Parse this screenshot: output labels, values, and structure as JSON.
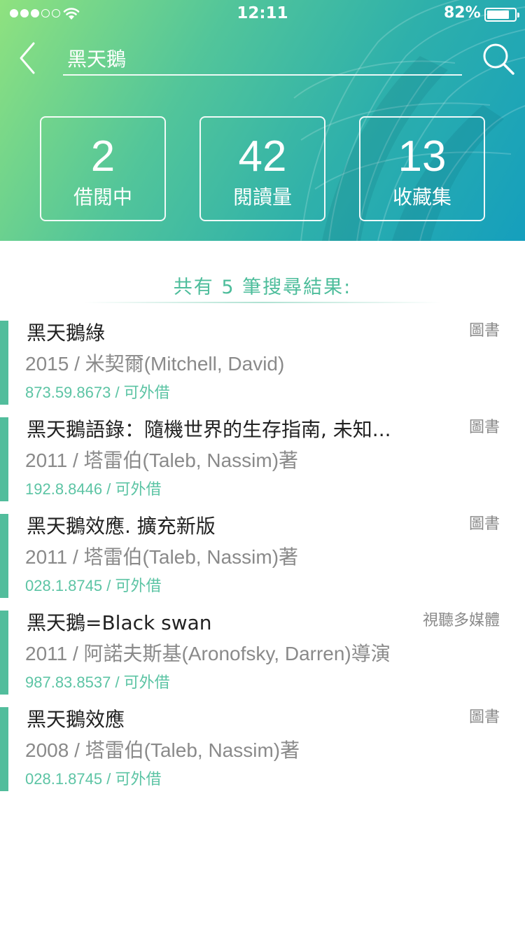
{
  "status_bar": {
    "time": "12:11",
    "battery_percent": "82%",
    "battery_level": 0.82,
    "signal_bars_filled": 3,
    "signal_bars_total": 5
  },
  "search": {
    "query": "黑天鵝",
    "back_icon": "chevron-left-icon",
    "search_icon": "magnifier-icon"
  },
  "stats": [
    {
      "value": "2",
      "label": "借閱中"
    },
    {
      "value": "42",
      "label": "閱讀量"
    },
    {
      "value": "13",
      "label": "收藏集"
    }
  ],
  "results": {
    "summary": "共有 5 筆搜尋結果:",
    "items": [
      {
        "title": "黑天鵝綠",
        "type": "圖書",
        "meta": "2015 / 米契爾(Mitchell, David)",
        "call": "873.59.8673 / 可外借"
      },
      {
        "title": "黑天鵝語錄：隨機世界的生存指南, 未知...",
        "type": "圖書",
        "meta": "2011 / 塔雷伯(Taleb, Nassim)著",
        "call": "192.8.8446 / 可外借"
      },
      {
        "title": "黑天鵝效應. 擴充新版",
        "type": "圖書",
        "meta": "2011 / 塔雷伯(Taleb, Nassim)著",
        "call": "028.1.8745 / 可外借"
      },
      {
        "title": "黑天鵝=Black swan",
        "type": "視聽多媒體",
        "meta": "2011 / 阿諾夫斯基(Aronofsky, Darren)導演",
        "call": "987.83.8537 / 可外借"
      },
      {
        "title": "黑天鵝效應",
        "type": "圖書",
        "meta": "2008 / 塔雷伯(Taleb, Nassim)著",
        "call": "028.1.8745 / 可外借"
      }
    ]
  },
  "colors": {
    "accent": "#52bd9c",
    "header_gradient_start": "#8fe27f",
    "header_gradient_end": "#159fbd",
    "secondary_text": "#8a8a8a"
  }
}
